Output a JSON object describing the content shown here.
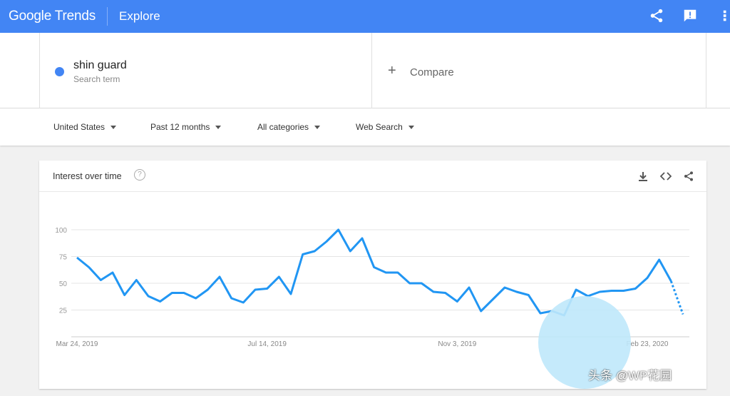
{
  "header": {
    "logo": "Google Trends",
    "section": "Explore",
    "icons": [
      "share-icon",
      "feedback-icon",
      "apps-icon"
    ],
    "color": "#4285f4"
  },
  "term": {
    "name": "shin guard",
    "subtitle": "Search term",
    "color": "#4285f4"
  },
  "compare": {
    "label": "Compare"
  },
  "filters": [
    {
      "label": "United States"
    },
    {
      "label": "Past 12 months"
    },
    {
      "label": "All categories"
    },
    {
      "label": "Web Search"
    }
  ],
  "card": {
    "title": "Interest over time",
    "icons": [
      "download-icon",
      "embed-icon",
      "share-icon"
    ]
  },
  "chart_data": {
    "type": "line",
    "title": "Interest over time",
    "x_tick_labels": [
      "Mar 24, 2019",
      "Jul 14, 2019",
      "Nov 3, 2019",
      "Feb 23, 2020"
    ],
    "x_start": "Mar 24, 2019",
    "x_interval": "weekly",
    "y_ticks": [
      25,
      50,
      75,
      100
    ],
    "ylim": [
      0,
      100
    ],
    "grid": true,
    "series": [
      {
        "color": "#2196f3",
        "values": [
          74,
          65,
          53,
          60,
          39,
          53,
          38,
          33,
          41,
          41,
          36,
          44,
          56,
          36,
          32,
          44,
          45,
          56,
          40,
          77,
          80,
          89,
          100,
          80,
          92,
          65,
          60,
          60,
          50,
          50,
          42,
          41,
          33,
          46,
          24,
          35,
          46,
          42,
          39,
          22,
          24,
          20,
          44,
          38,
          42,
          43,
          43,
          45,
          55,
          72,
          52,
          21
        ],
        "partial_last_point": true
      }
    ]
  },
  "watermark": "头条 @WP花园"
}
